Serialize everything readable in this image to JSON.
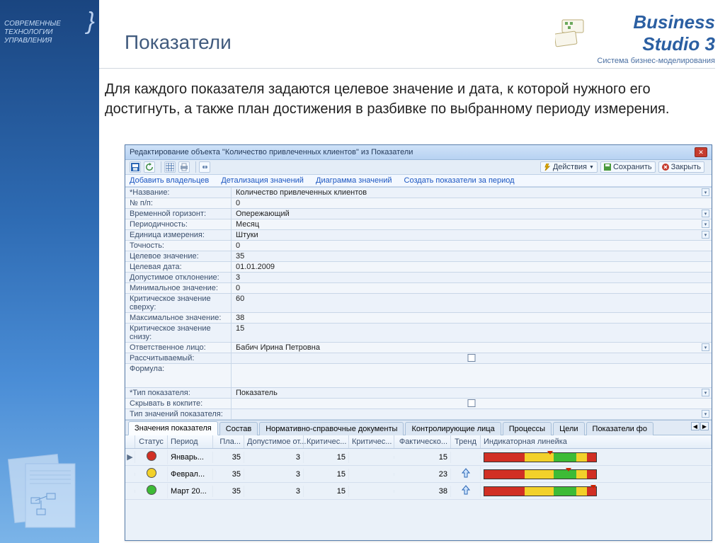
{
  "corp": {
    "l1": "СОВРЕМЕННЫЕ",
    "l2": "ТЕХНОЛОГИИ",
    "l3": "УПРАВЛЕНИЯ"
  },
  "brand": {
    "title_a": "Business",
    "title_b": "Studio",
    "title_ver": "3",
    "sub": "Система бизнес-моделирования"
  },
  "heading": "Показатели",
  "body_text": "Для каждого показателя задаются целевое значение и дата, к которой нужного его достигнуть, а также план достижения  в разбивке по выбранному периоду измерения.",
  "window": {
    "title": "Редактирование объекта \"Количество привлеченных клиентов\" из Показатели",
    "actions": "Действия",
    "save": "Сохранить",
    "close": "Закрыть"
  },
  "links": {
    "add_owners": "Добавить владельцев",
    "detail": "Детализация значений",
    "diagram": "Диаграмма значений",
    "create_period": "Создать показатели за период"
  },
  "form": [
    {
      "label": "Название:",
      "value": "Количество привлеченных клиентов",
      "req": true,
      "dd": true
    },
    {
      "label": "№ п/п:",
      "value": "0"
    },
    {
      "label": "Временной горизонт:",
      "value": "Опережающий",
      "dd": true
    },
    {
      "label": "Периодичность:",
      "value": "Месяц",
      "dd": true
    },
    {
      "label": "Единица измерения:",
      "value": "Штуки",
      "dd": true
    },
    {
      "label": "Точность:",
      "value": "0"
    },
    {
      "label": "Целевое значение:",
      "value": "35"
    },
    {
      "label": "Целевая дата:",
      "value": "01.01.2009"
    },
    {
      "label": "Допустимое отклонение:",
      "value": "3"
    },
    {
      "label": "Минимальное значение:",
      "value": "0"
    },
    {
      "label": "Критическое значение сверху:",
      "value": "60"
    },
    {
      "label": "Максимальное значение:",
      "value": "38"
    },
    {
      "label": "Критическое значение снизу:",
      "value": "15"
    },
    {
      "label": "Ответственное лицо:",
      "value": "Бабич Ирина Петровна",
      "dd": true
    },
    {
      "label": "Рассчитываемый:",
      "checkbox": true
    },
    {
      "label": "Формула:",
      "value": "",
      "tall": true
    },
    {
      "label": "Тип показателя:",
      "value": "Показатель",
      "req": true,
      "dd": true
    },
    {
      "label": "Скрывать в кокпите:",
      "checkbox": true
    },
    {
      "label": "Тип значений показателя:",
      "value": "",
      "dd": true
    }
  ],
  "tabs": [
    "Значения показателя",
    "Состав",
    "Нормативно-справочные документы",
    "Контролирующие лица",
    "Процессы",
    "Цели",
    "Показатели фо"
  ],
  "grid": {
    "columns": [
      "Статус",
      "Период",
      "Пла...",
      "Допустимое от...",
      "Критичес...",
      "Критичес...",
      "Фактическо...",
      "Тренд",
      "Индикаторная линейка"
    ],
    "rows": [
      {
        "status": "red",
        "period": "Январь...",
        "plan": 35,
        "dev": 3,
        "c1": 15,
        "c2": "",
        "fact": 15,
        "trend": "",
        "mark": 0.56
      },
      {
        "status": "yellow",
        "period": "Феврал...",
        "plan": 35,
        "dev": 3,
        "c1": 15,
        "c2": "",
        "fact": 23,
        "trend": "up",
        "mark": 0.72
      },
      {
        "status": "green",
        "period": "Март 20...",
        "plan": 35,
        "dev": 3,
        "c1": 15,
        "c2": "",
        "fact": 38,
        "trend": "up",
        "mark": 0.94
      }
    ]
  }
}
